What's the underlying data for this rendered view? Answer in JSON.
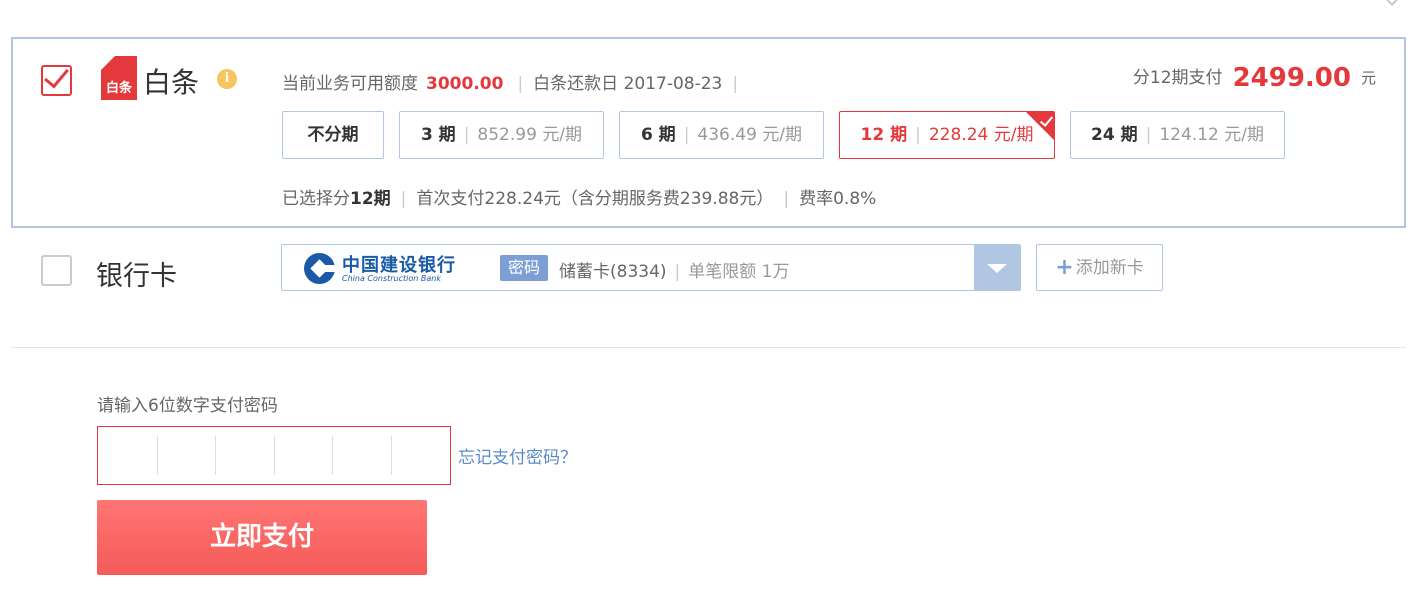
{
  "baitiao": {
    "name": "白条",
    "logo_text": "白条",
    "info_icon": "i",
    "credit_label": "当前业务可用额度",
    "credit_value": "3000.00",
    "repay_label": "白条还款日",
    "repay_date": "2017-08-23",
    "total_prefix": "分12期支付",
    "total_amount": "2499.00",
    "total_unit": "元",
    "plans": [
      {
        "term": "不分期",
        "amount": "",
        "unit": ""
      },
      {
        "term": "3 期",
        "amount": "852.99",
        "unit": "元/期"
      },
      {
        "term": "6 期",
        "amount": "436.49",
        "unit": "元/期"
      },
      {
        "term": "12 期",
        "amount": "228.24",
        "unit": "元/期"
      },
      {
        "term": "24 期",
        "amount": "124.12",
        "unit": "元/期"
      }
    ],
    "selected_plan_index": 3,
    "summary": {
      "selected_prefix": "已选择分",
      "selected_term": "12期",
      "first_pay": "首次支付228.24元（含分期服务费239.88元）",
      "rate": "费率0.8%"
    }
  },
  "bank": {
    "label": "银行卡",
    "bank_name_cn": "中国建设银行",
    "bank_name_en": "China Construction Bank",
    "auth_badge": "密码",
    "card_desc": "储蓄卡(8334)",
    "limit": "单笔限额 1万",
    "add_card_label": "添加新卡"
  },
  "password": {
    "prompt": "请输入6位数字支付密码",
    "forgot_link": "忘记支付密码？",
    "digits": 6
  },
  "pay_button": "立即支付",
  "colors": {
    "accent_red": "#e4393c",
    "border_blue": "#b1c6e3",
    "badge_blue": "#7e9fd4",
    "link_blue": "#5b8ac6",
    "info_yellow": "#f7c55f"
  },
  "icons": [
    "checkbox-checked-icon",
    "baitiao-logo-icon",
    "info-icon",
    "check-corner-icon",
    "ccb-logo-icon",
    "dropdown-arrow-icon",
    "plus-icon"
  ]
}
